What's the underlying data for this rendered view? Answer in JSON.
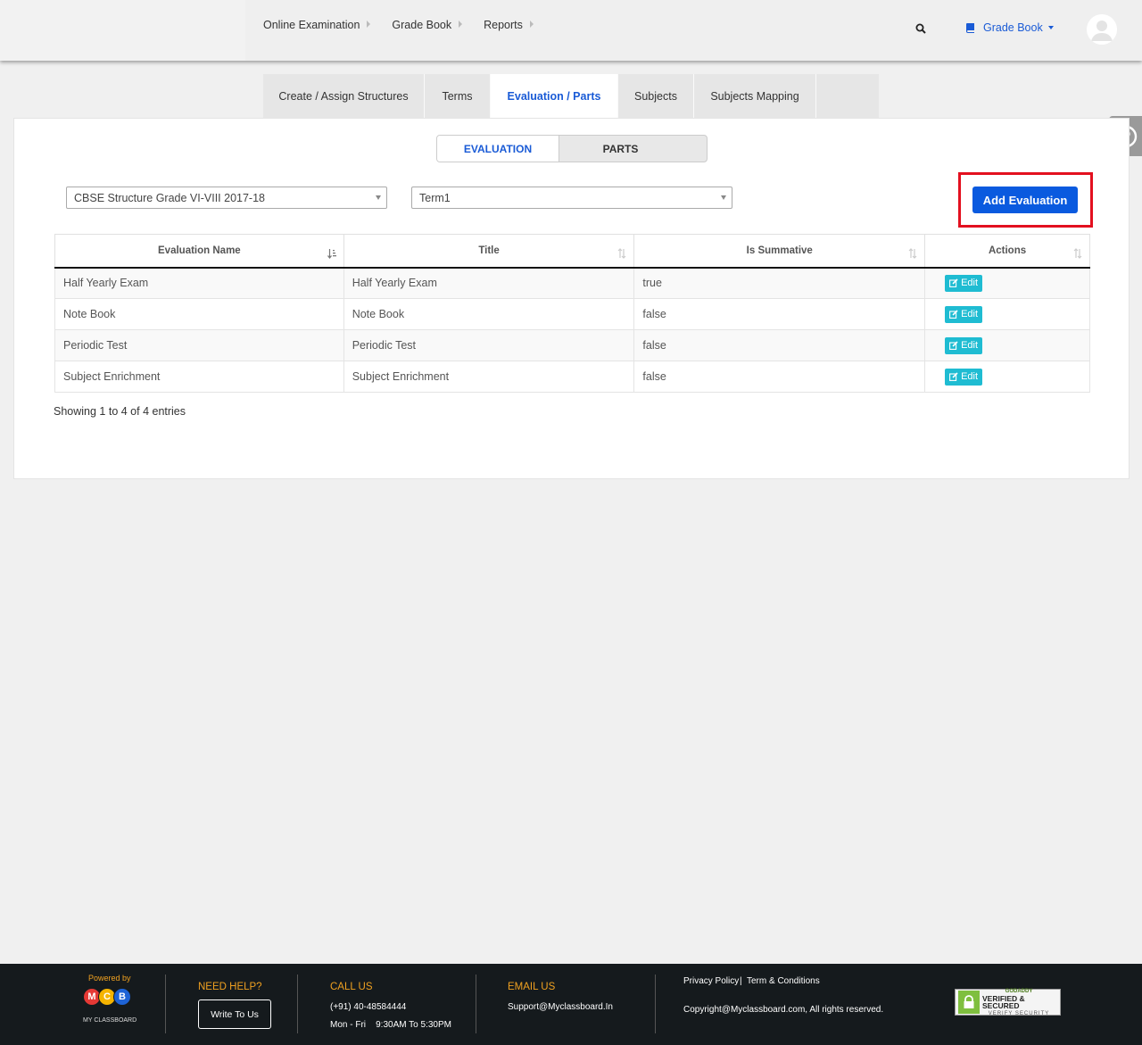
{
  "nav": {
    "items": [
      "Online Examination",
      "Grade Book",
      "Reports"
    ],
    "module_label": "Grade Book"
  },
  "tabs": [
    {
      "label": "Create / Assign Structures",
      "active": false
    },
    {
      "label": "Terms",
      "active": false
    },
    {
      "label": "Evaluation / Parts",
      "active": true
    },
    {
      "label": "Subjects",
      "active": false
    },
    {
      "label": "Subjects Mapping",
      "active": false
    }
  ],
  "toggle": {
    "evaluation": "EVALUATION",
    "parts": "PARTS",
    "selected": "EVALUATION"
  },
  "filters": {
    "structure": "CBSE Structure Grade VI-VIII 2017-18",
    "term": "Term1"
  },
  "add_button": "Add Evaluation",
  "table": {
    "headers": [
      "Evaluation Name",
      "Title",
      "Is Summative",
      "Actions"
    ],
    "rows": [
      {
        "name": "Half Yearly Exam",
        "title": "Half Yearly Exam",
        "summative": "true",
        "action": "Edit"
      },
      {
        "name": "Note Book",
        "title": "Note Book",
        "summative": "false",
        "action": "Edit"
      },
      {
        "name": "Periodic Test",
        "title": "Periodic Test",
        "summative": "false",
        "action": "Edit"
      },
      {
        "name": "Subject Enrichment",
        "title": "Subject Enrichment",
        "summative": "false",
        "action": "Edit"
      }
    ],
    "info": "Showing 1 to 4 of 4 entries"
  },
  "footer": {
    "powered_by": "Powered by",
    "brand_letters": [
      "M",
      "C",
      "B"
    ],
    "brand_name": "MY CLASSBOARD",
    "need_help": "NEED HELP?",
    "write_to_us": "Write To Us",
    "call_us": "CALL US",
    "phone": "(+91) 40-48584444",
    "hours": "Mon - Fri    9:30AM To 5:30PM",
    "email_us": "EMAIL US",
    "email": "Support@Myclassboard.In",
    "privacy": "Privacy Policy",
    "sep": "|",
    "terms": "Term & Conditions",
    "copyright": "Copyright@Myclassboard.com, All rights reserved.",
    "badge_top": "GODADDY",
    "badge_main": "VERIFIED & SECURED",
    "badge_sub": "VERIFY SECURITY"
  },
  "colors": {
    "accent": "#1a5bd6",
    "button": "#0a5adf",
    "highlight": "#e3101f",
    "edit": "#1fbcd2",
    "footer_heading": "#f0a120"
  }
}
